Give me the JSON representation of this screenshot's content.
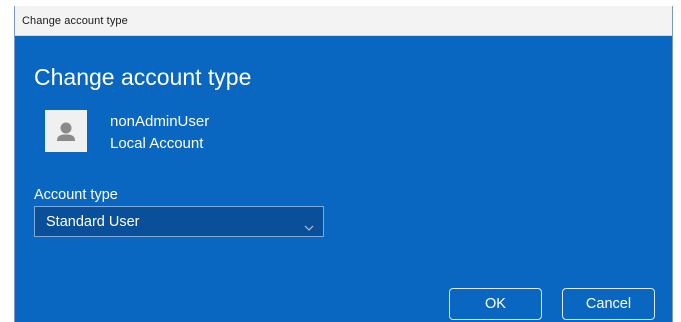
{
  "window": {
    "title": "Change account type"
  },
  "dialog": {
    "heading": "Change account type",
    "user": {
      "name": "nonAdminUser",
      "account_kind": "Local Account",
      "avatar_icon": "person-icon"
    },
    "account_type": {
      "label": "Account type",
      "selected": "Standard User"
    },
    "buttons": {
      "ok": "OK",
      "cancel": "Cancel"
    }
  },
  "colors": {
    "background": "#0a67c1",
    "titlebar": "#f3f3f3",
    "select_background": "#0a4f99",
    "text": "#ffffff"
  }
}
